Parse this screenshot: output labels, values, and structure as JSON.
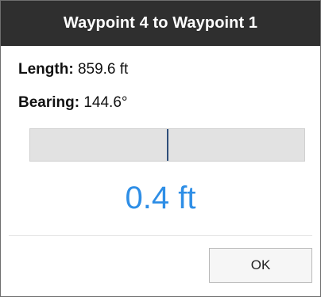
{
  "dialog": {
    "title": "Waypoint 4 to Waypoint 1",
    "length": {
      "label": "Length:",
      "value": "859.6 ft"
    },
    "bearing": {
      "label": "Bearing:",
      "value": "144.6°"
    },
    "slider": {
      "position_fraction": 0.5
    },
    "readout": "0.4 ft",
    "ok_label": "OK"
  },
  "colors": {
    "titlebar_bg": "#2f2f2f",
    "readout": "#2e8ee6",
    "slider_track": "#e2e2e2",
    "slider_marker": "#2f4f7a"
  }
}
